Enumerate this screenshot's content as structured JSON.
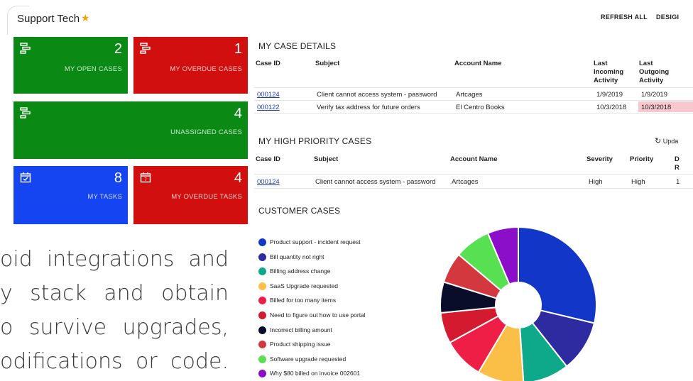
{
  "header": {
    "title": "Support Tech",
    "star": "★",
    "refresh_label": "REFRESH ALL",
    "design_label": "DESIGI"
  },
  "tiles": [
    {
      "count": "2",
      "label": "MY OPEN CASES",
      "icon": "cases-icon",
      "color": "#0a8a14"
    },
    {
      "count": "1",
      "label": "MY OVERDUE CASES",
      "icon": "cases-icon",
      "color": "#d20f0f"
    },
    {
      "count": "4",
      "label": "UNASSIGNED CASES",
      "icon": "cases-icon",
      "color": "#0a8a14"
    },
    {
      "count": "8",
      "label": "MY TASKS",
      "icon": "calendar-check-icon",
      "color": "#1545f0"
    },
    {
      "count": "4",
      "label": "MY OVERDUE TASKS",
      "icon": "calendar-7-icon",
      "color": "#d20f0f"
    }
  ],
  "case_details": {
    "title": "MY CASE DETAILS",
    "headers": [
      "Case ID",
      "Subject",
      "Account Name",
      "Last Incoming Activity",
      "Last Outgoing Activity"
    ],
    "header_lines": {
      "last_incoming": [
        "Last",
        "Incoming",
        "Activity"
      ],
      "last_outgoing": [
        "Last",
        "Outgoing",
        "Activity"
      ]
    },
    "rows": [
      {
        "case_id": "000124",
        "subject": "Client cannot access system - password",
        "account": "Artcages",
        "incoming": "1/9/2019",
        "outgoing": "1/9/2019"
      },
      {
        "case_id": "000122",
        "subject": "Verify tax address for future orders",
        "account": "El Centro Books",
        "incoming": "10/3/2018",
        "outgoing": "10/3/2018"
      }
    ]
  },
  "high_priority": {
    "title": "MY HIGH PRIORITY CASES",
    "update_label": "Upda",
    "headers": [
      "Case ID",
      "Subject",
      "Account Name",
      "Severity",
      "Priority",
      "D",
      "R"
    ],
    "rows": [
      {
        "case_id": "000124",
        "subject": "Client cannot access system - password",
        "account": "Artcages",
        "severity": "High",
        "priority": "High",
        "extra": "1"
      }
    ]
  },
  "customer_cases": {
    "title": "CUSTOMER CASES",
    "legend": [
      {
        "label": "Product support - incident request",
        "color": "#1237c8"
      },
      {
        "label": "Bill quantity not right",
        "color": "#2e2aa0"
      },
      {
        "label": "Billing address change",
        "color": "#0ea88a"
      },
      {
        "label": "SaaS Upgrade requested",
        "color": "#fbbf48"
      },
      {
        "label": "Billed for too many items",
        "color": "#ee1e46"
      },
      {
        "label": "Need to figure out how to use portal",
        "color": "#d41a2e"
      },
      {
        "label": "Incorrect billing amount",
        "color": "#0a0d2a"
      },
      {
        "label": "Product shipping issue",
        "color": "#d4383f"
      },
      {
        "label": "Software upgrade requested",
        "color": "#56e052"
      },
      {
        "label": "Why $80 billed on invoice 002601",
        "color": "#8b0fc9"
      }
    ]
  },
  "chart_data": {
    "type": "pie",
    "categories": [
      "Product support - incident request",
      "Bill quantity not right",
      "Billing address change",
      "SaaS Upgrade requested",
      "Billed for too many items",
      "Need to figure out how to use portal",
      "Incorrect billing amount",
      "Product shipping issue",
      "Software upgrade requested",
      "Why $80 billed on invoice 002601"
    ],
    "values": [
      27,
      10,
      9,
      9,
      8,
      6,
      6,
      6,
      7,
      6
    ],
    "colors": [
      "#1237c8",
      "#2e2aa0",
      "#0ea88a",
      "#fbbf48",
      "#ee1e46",
      "#d41a2e",
      "#0a0d2a",
      "#d4383f",
      "#56e052",
      "#8b0fc9"
    ],
    "donut": true
  },
  "overlay_text": {
    "lines": [
      "oid  integrations  and",
      "y  stack  and  obtain",
      "o  survive  upgrades,",
      "odifications  or  code."
    ]
  }
}
